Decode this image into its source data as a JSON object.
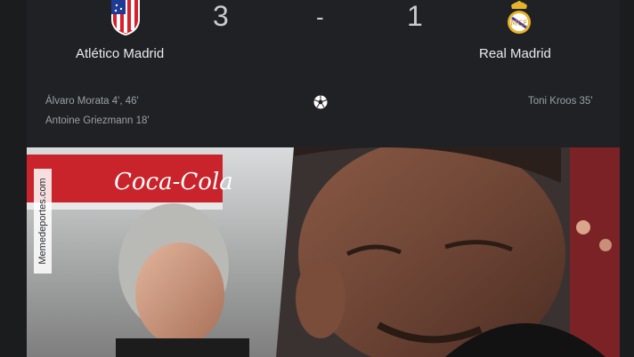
{
  "match": {
    "home": {
      "name": "Atlético Madrid",
      "score": "3",
      "crest": "atletico-madrid-crest"
    },
    "away": {
      "name": "Real Madrid",
      "score": "1",
      "crest": "real-madrid-crest"
    },
    "separator": "-",
    "goals": {
      "home": [
        "Álvaro Morata 4', 46'",
        "Antoine Griezmann 18'"
      ],
      "away": [
        "Toni Kroos 35'"
      ]
    },
    "goal_icon": "soccer-ball-icon"
  },
  "image": {
    "watermark": "Memedeportes.com",
    "banner": "Coca-Cola"
  },
  "colors": {
    "card_bg": "#202124",
    "text_primary": "#e8eaed",
    "text_secondary": "#9aa0a6",
    "atletico_red": "#d6202a",
    "atletico_blue": "#1f3a93",
    "real_gold": "#e6b42a"
  }
}
